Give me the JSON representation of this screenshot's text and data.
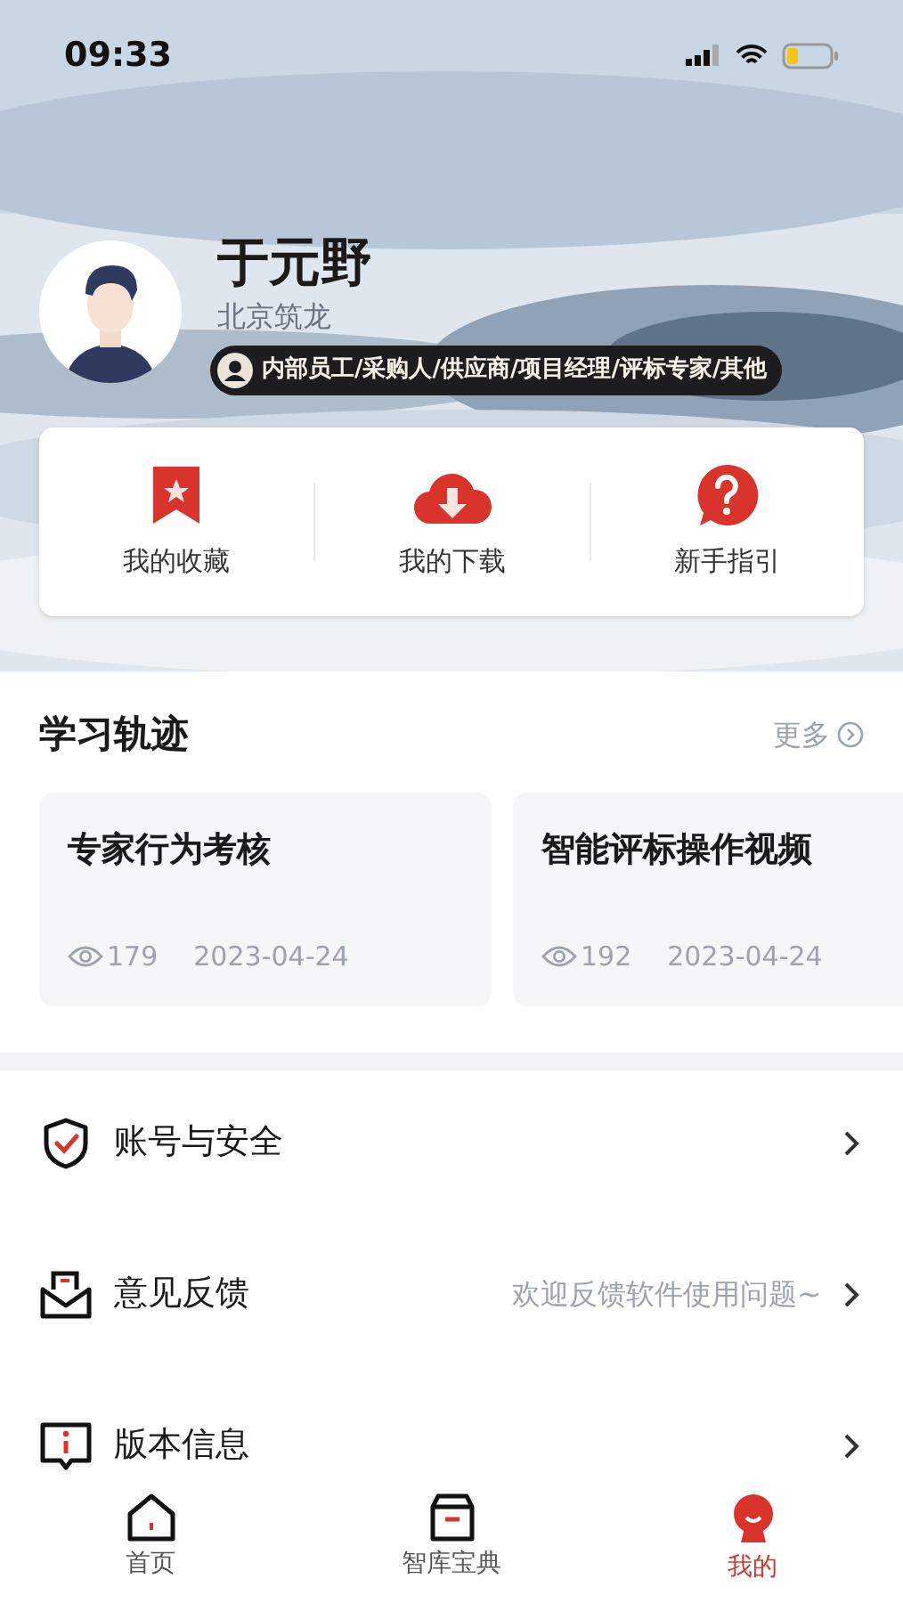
{
  "status_bar": {
    "time": "09:33"
  },
  "profile": {
    "name": "于元野",
    "company": "北京筑龙",
    "roles": "内部员工/采购人/供应商/项目经理/评标专家/其他"
  },
  "shortcuts": [
    {
      "label": "我的收藏",
      "kind": "bookmark"
    },
    {
      "label": "我的下载",
      "kind": "download"
    },
    {
      "label": "新手指引",
      "kind": "help"
    }
  ],
  "learning": {
    "title": "学习轨迹",
    "more": "更多",
    "cards": [
      {
        "title": "专家行为考核",
        "views": "179",
        "date": "2023-04-24"
      },
      {
        "title": "智能评标操作视频",
        "views": "192",
        "date": "2023-04-24"
      }
    ]
  },
  "menu": [
    {
      "label": "账号与安全",
      "kind": "shield"
    },
    {
      "label": "意见反馈",
      "hint": "欢迎反馈软件使用问题~",
      "kind": "mail"
    },
    {
      "label": "版本信息",
      "kind": "info"
    }
  ],
  "tab_bar": [
    {
      "label": "首页",
      "kind": "home",
      "selected": false
    },
    {
      "label": "智库宝典",
      "kind": "box",
      "selected": false
    },
    {
      "label": "我的",
      "kind": "user",
      "selected": true
    }
  ]
}
